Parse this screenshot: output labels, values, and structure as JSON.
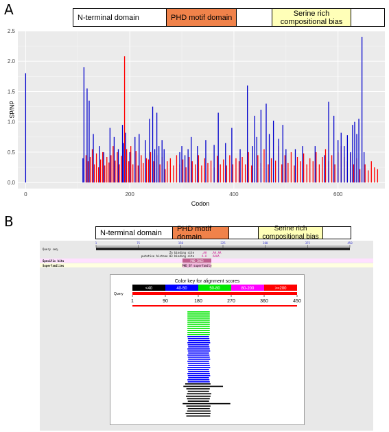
{
  "panel_a_label": "A",
  "panel_b_label": "B",
  "domains_a": [
    {
      "label": "N-terminal domain"
    },
    {
      "label": "PHD motif domain"
    },
    {
      "label": "Serine rich compositional bias"
    }
  ],
  "domains_b": [
    {
      "label": "N-terminal domain"
    },
    {
      "label": "PHD motif domain"
    },
    {
      "label": "Serine rich compositional bias"
    }
  ],
  "colors": {
    "red": "#ff0000",
    "blue": "#0000cc",
    "plot_bg": "#ebebeb",
    "phd": "#f0824a",
    "serine": "#ffffb8"
  },
  "chart_data": {
    "type": "bar",
    "xlabel": "Codon",
    "ylabel": "dN/dS",
    "xlim": [
      -15,
      690
    ],
    "ylim": [
      -0.1,
      2.5
    ],
    "xticks": [
      0,
      200,
      400,
      600
    ],
    "yticks": [
      0.0,
      0.5,
      1.0,
      1.5,
      2.0,
      2.5
    ],
    "grid": true,
    "series": [
      {
        "color": "red",
        "x": [
          116,
          120,
          124,
          128,
          132,
          136,
          140,
          144,
          148,
          152,
          156,
          160,
          164,
          168,
          172,
          176,
          180,
          184,
          190,
          194,
          198,
          202,
          206,
          212,
          216,
          222,
          226,
          232,
          236,
          240,
          246,
          252,
          258,
          262,
          268,
          272,
          278,
          284,
          290,
          296,
          302,
          308,
          314,
          320,
          326,
          332,
          338,
          344,
          350,
          356,
          362,
          368,
          374,
          380,
          386,
          392,
          398,
          404,
          410,
          416,
          422,
          428,
          434,
          446,
          452,
          458,
          466,
          472,
          480,
          486,
          492,
          498,
          504,
          510,
          516,
          522,
          528,
          534,
          540,
          546,
          552,
          558,
          564,
          570,
          576,
          582,
          588,
          594,
          600,
          606,
          612,
          618,
          624,
          630,
          636,
          642,
          652,
          658,
          664,
          670,
          676
        ],
        "values": [
          0.45,
          0.35,
          0.42,
          0.55,
          0.3,
          0.48,
          0.25,
          0.38,
          0.5,
          0.28,
          0.42,
          0.33,
          0.45,
          0.6,
          0.36,
          0.5,
          0.3,
          0.44,
          2.08,
          0.55,
          0.35,
          0.6,
          0.3,
          0.52,
          0.28,
          0.45,
          0.32,
          0.4,
          0.38,
          0.5,
          0.35,
          0.45,
          0.3,
          0.42,
          0.22,
          0.35,
          0.4,
          0.28,
          0.45,
          0.3,
          0.38,
          0.25,
          0.42,
          0.35,
          0.3,
          0.45,
          0.28,
          0.4,
          0.32,
          0.36,
          0.25,
          0.44,
          0.3,
          0.38,
          0.28,
          0.45,
          0.3,
          0.4,
          0.35,
          0.42,
          0.3,
          0.5,
          0.28,
          0.45,
          0.32,
          0.55,
          0.3,
          0.4,
          0.36,
          0.6,
          0.3,
          0.45,
          0.32,
          0.5,
          0.28,
          0.42,
          0.35,
          0.48,
          0.3,
          0.4,
          0.35,
          0.5,
          0.3,
          0.42,
          0.55,
          0.35,
          0.45,
          0.3,
          0.5,
          0.6,
          0.42,
          0.35,
          0.48,
          0.3,
          0.4,
          0.22,
          0.3,
          0.2,
          0.35,
          0.25,
          0.22
        ]
      },
      {
        "color": "blue",
        "x": [
          0,
          110,
          112,
          118,
          122,
          130,
          142,
          150,
          162,
          170,
          178,
          186,
          188,
          192,
          200,
          210,
          218,
          230,
          238,
          244,
          248,
          252,
          256,
          262,
          266,
          296,
          300,
          306,
          312,
          318,
          330,
          346,
          362,
          370,
          384,
          396,
          412,
          426,
          436,
          440,
          444,
          452,
          462,
          468,
          476,
          486,
          494,
          500,
          518,
          532,
          556,
          574,
          582,
          592,
          600,
          606,
          612,
          618,
          624,
          628,
          632,
          636,
          640,
          646,
          650
        ],
        "values": [
          1.8,
          0.4,
          1.9,
          1.55,
          1.35,
          0.8,
          0.6,
          0.5,
          0.9,
          0.75,
          0.55,
          0.95,
          0.65,
          0.82,
          0.5,
          0.75,
          0.8,
          0.7,
          1.05,
          1.25,
          0.55,
          1.15,
          0.6,
          0.7,
          0.55,
          0.5,
          0.6,
          0.45,
          0.55,
          0.75,
          0.6,
          0.7,
          0.62,
          1.15,
          0.65,
          0.9,
          0.55,
          1.6,
          0.6,
          1.1,
          0.75,
          1.2,
          1.3,
          0.8,
          1.02,
          0.72,
          0.95,
          0.55,
          0.55,
          0.6,
          0.6,
          0.45,
          1.33,
          1.1,
          0.7,
          0.82,
          0.6,
          0.78,
          0.5,
          0.95,
          1.0,
          0.8,
          1.05,
          2.4,
          0.5
        ]
      }
    ]
  },
  "cdd": {
    "query_label": "Query seq.",
    "ticks": [
      "1",
      "75",
      "150",
      "225",
      "300",
      "375",
      "450"
    ],
    "annot_1": "Zn binding site",
    "annot_2": "putative histone H3 binding site",
    "specific_hits_label": "Specific hits",
    "specific_hit": "PHD_ING3",
    "superfamilies_label": "Superfamilies",
    "superfamily": "PHD_SF superfamily"
  },
  "blast": {
    "color_key_title": "Color key for alignment scores",
    "key": [
      {
        "label": "<40",
        "color": "#000000"
      },
      {
        "label": "40-50",
        "color": "#0000ff"
      },
      {
        "label": "50-80",
        "color": "#00e600"
      },
      {
        "label": "80-200",
        "color": "#ff00ff"
      },
      {
        "label": ">=200",
        "color": "#ff0000"
      }
    ],
    "query_label": "Query",
    "scale": [
      "1",
      "90",
      "180",
      "270",
      "360",
      "450"
    ]
  }
}
